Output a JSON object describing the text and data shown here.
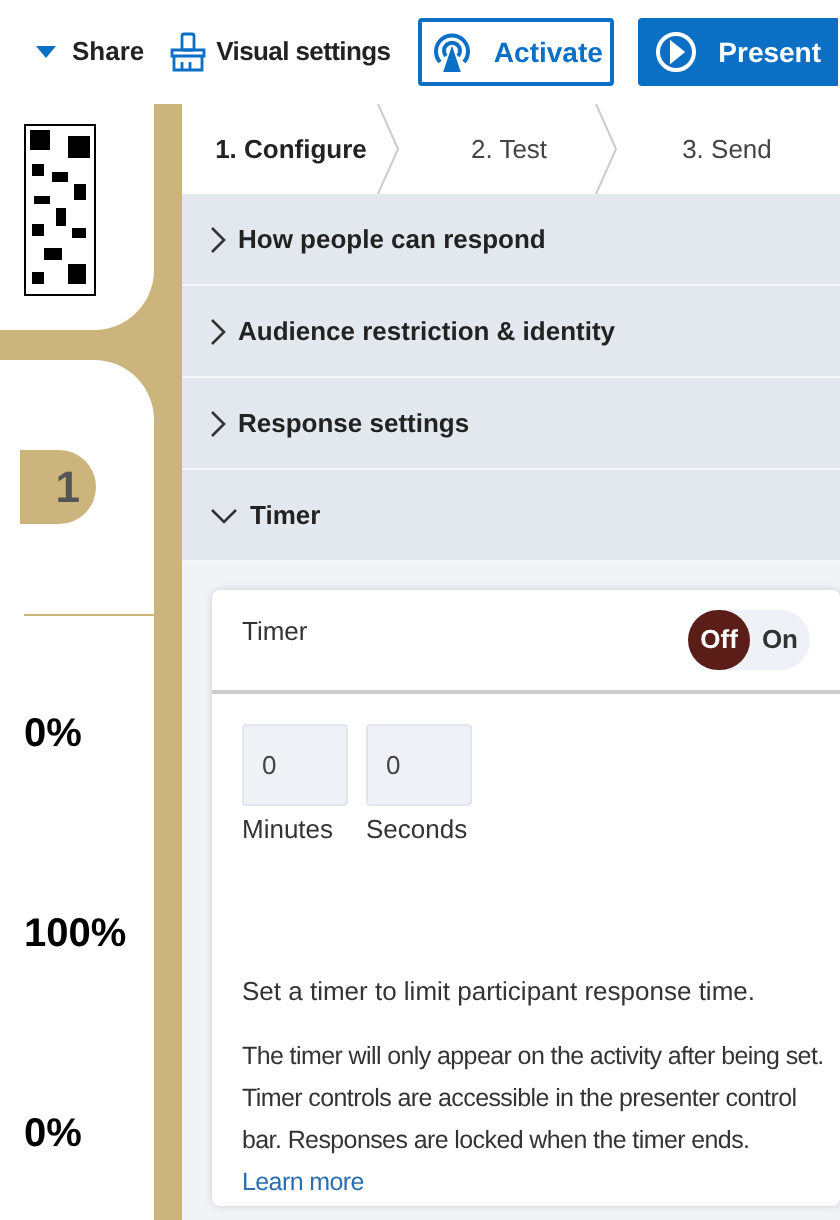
{
  "toolbar": {
    "share": "Share",
    "visual_settings": "Visual settings",
    "activate": "Activate",
    "present": "Present"
  },
  "preview": {
    "badge": "1",
    "percentages": [
      "0%",
      "100%",
      "0%"
    ]
  },
  "steps": [
    {
      "label": "1. Configure",
      "selected": true
    },
    {
      "label": "2. Test",
      "selected": false
    },
    {
      "label": "3. Send",
      "selected": false
    }
  ],
  "sections": [
    {
      "title": "How people can respond",
      "expanded": false
    },
    {
      "title": "Audience restriction & identity",
      "expanded": false
    },
    {
      "title": "Response settings",
      "expanded": false
    },
    {
      "title": "Timer",
      "expanded": true
    }
  ],
  "timer": {
    "label": "Timer",
    "toggle": {
      "on": false,
      "off_label": "Off",
      "on_label": "On"
    },
    "fields": [
      {
        "value": "0",
        "label": "Minutes"
      },
      {
        "value": "0",
        "label": "Seconds"
      }
    ],
    "hint": "Set a timer to limit participant response time.",
    "info": "The timer will only appear on the activity after being set. Timer controls are accessible in the presenter control bar. Responses are locked when the timer ends.",
    "link": "Learn more"
  }
}
